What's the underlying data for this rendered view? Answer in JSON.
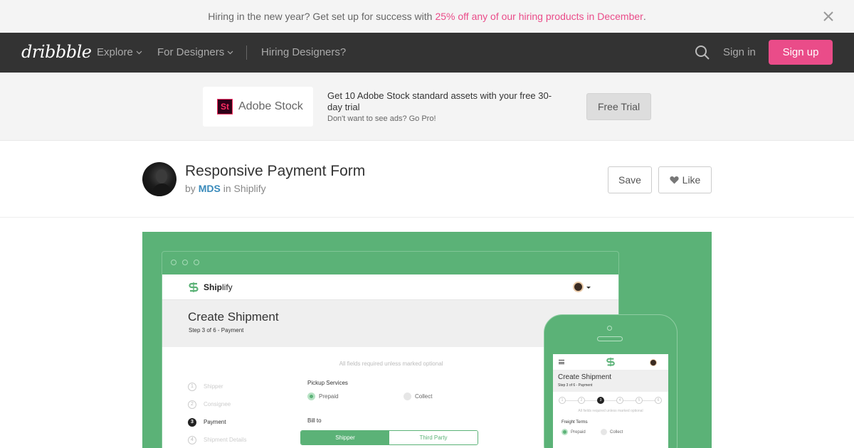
{
  "promo": {
    "text": "Hiring in the new year? Get set up for success with",
    "highlight": "25% off any of our hiring products in December",
    "period": ".",
    "close_icon": "close-icon"
  },
  "nav": {
    "logo": "dribbble",
    "items": [
      {
        "label": "Explore",
        "has_dropdown": true
      },
      {
        "label": "For Designers",
        "has_dropdown": true
      },
      {
        "label": "Hiring Designers?",
        "has_dropdown": false
      }
    ],
    "search_icon": "search-icon",
    "signin": "Sign in",
    "signup": "Sign up"
  },
  "ad": {
    "logo_mark": "St",
    "brand": "Adobe Stock",
    "text": "Get 10 Adobe Stock standard assets with your free 30-day trial",
    "sub": "Don't want to see ads? Go Pro!",
    "button": "Free Trial"
  },
  "shot": {
    "title": "Responsive Payment Form",
    "by": "by",
    "author": "MDS",
    "in": "in",
    "team": "Shiplify",
    "save": "Save",
    "like": "Like"
  },
  "mockup": {
    "logo_bold": "Ship",
    "logo_rest": "lify",
    "title": "Create Shipment",
    "step": "Step 3 of 6 - Payment",
    "required": "All fields required unless marked optional",
    "steps": [
      {
        "num": "1",
        "label": "Shipper"
      },
      {
        "num": "2",
        "label": "Consignee"
      },
      {
        "num": "3",
        "label": "Payment"
      },
      {
        "num": "4",
        "label": "Shipment Details"
      }
    ],
    "active_step": 3,
    "pickup_label": "Pickup Services",
    "pickup_options": [
      "Prepaid",
      "Collect"
    ],
    "bill_label": "Bill to",
    "bill_options": [
      "Shipper",
      "Third Party"
    ],
    "mobile": {
      "title": "Create Shipment",
      "step": "Step 3 of 6 - Payment",
      "step_nums": [
        "1",
        "2",
        "3",
        "4",
        "5",
        "6"
      ],
      "required": "All fields required unless marked optional",
      "freight_label": "Freight Terms",
      "freight_options": [
        "Prepaid",
        "Collect"
      ]
    }
  },
  "colors": {
    "brand_pink": "#ea4c89",
    "nav_bg": "#333333",
    "shot_green": "#5bb277",
    "author_blue": "#3a8bbb"
  }
}
